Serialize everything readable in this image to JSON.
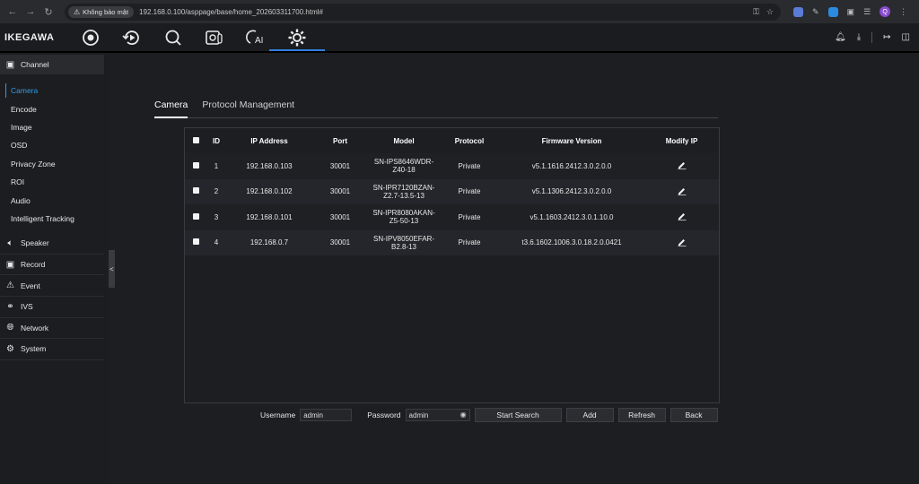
{
  "browser": {
    "security_label": "Không bảo mật",
    "url": "192.168.0.100/asppage/base/home_202603311700.html#",
    "profile_initial": "Q"
  },
  "app": {
    "logo": "IKEGAWA",
    "top_icons": [
      "live-view-icon",
      "playback-icon",
      "search-icon",
      "thermal-icon",
      "ai-icon",
      "settings-icon"
    ],
    "ai_label": "AI"
  },
  "sidebar": {
    "channel": {
      "label": "Channel",
      "items": [
        "Camera",
        "Encode",
        "Image",
        "OSD",
        "Privacy Zone",
        "ROI",
        "Audio",
        "Intelligent Tracking"
      ]
    },
    "groups": [
      {
        "label": "Speaker",
        "icon": "speaker-icon"
      },
      {
        "label": "Record",
        "icon": "record-icon"
      },
      {
        "label": "Event",
        "icon": "event-icon"
      },
      {
        "label": "IVS",
        "icon": "ivs-icon"
      },
      {
        "label": "Network",
        "icon": "network-icon"
      },
      {
        "label": "System",
        "icon": "system-icon"
      }
    ],
    "collapse_label": "<"
  },
  "tabs": [
    "Camera",
    "Protocol Management"
  ],
  "table": {
    "headers": [
      "ID",
      "IP Address",
      "Port",
      "Model",
      "Protocol",
      "Firmware Version",
      "Modify IP"
    ],
    "rows": [
      {
        "id": "1",
        "ip": "192.168.0.103",
        "port": "30001",
        "model_line1": "SN-IPS8646WDR-",
        "model_line2": "Z40-18",
        "protocol": "Private",
        "firmware": "v5.1.1616.2412.3.0.2.0.0"
      },
      {
        "id": "2",
        "ip": "192.168.0.102",
        "port": "30001",
        "model_line1": "SN-IPR7120BZAN-",
        "model_line2": "Z2.7-13.5-13",
        "protocol": "Private",
        "firmware": "v5.1.1306.2412.3.0.2.0.0"
      },
      {
        "id": "3",
        "ip": "192.168.0.101",
        "port": "30001",
        "model_line1": "SN-IPR8080AKAN-",
        "model_line2": "Z5-50-13",
        "protocol": "Private",
        "firmware": "v5.1.1603.2412.3.0.1.10.0"
      },
      {
        "id": "4",
        "ip": "192.168.0.7",
        "port": "30001",
        "model_line1": "SN-IPV8050EFAR-",
        "model_line2": "B2.8-13",
        "protocol": "Private",
        "firmware": "t3.6.1602.1006.3.0.18.2.0.0421"
      }
    ]
  },
  "bottom": {
    "username_label": "Username",
    "username_value": "admin",
    "password_label": "Password",
    "password_value": "admin",
    "start_search": "Start Search",
    "add": "Add",
    "refresh": "Refresh",
    "back": "Back"
  },
  "colors": {
    "accent": "#2f9be8",
    "active_underline": "#2f7fe0"
  }
}
